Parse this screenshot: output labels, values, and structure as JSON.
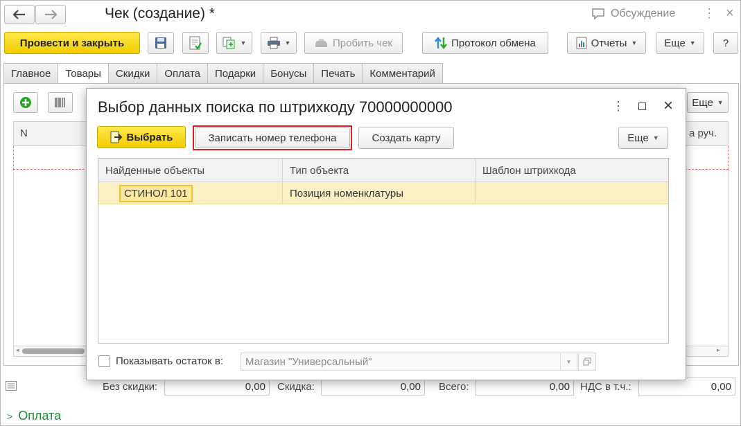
{
  "window": {
    "title": "Чек (создание) *",
    "discussion_label": "Обсуждение"
  },
  "toolbar": {
    "post_close_label": "Провести и закрыть",
    "print_check_label": "Пробить чек",
    "exchange_log_label": "Протокол обмена",
    "reports_label": "Отчеты",
    "more_label": "Еще",
    "help_label": "?"
  },
  "tabs": [
    {
      "label": "Главное"
    },
    {
      "label": "Товары"
    },
    {
      "label": "Скидки"
    },
    {
      "label": "Оплата"
    },
    {
      "label": "Подарки"
    },
    {
      "label": "Бонусы"
    },
    {
      "label": "Печать"
    },
    {
      "label": "Комментарий"
    }
  ],
  "goods": {
    "more_label": "Еще",
    "col_n": "N",
    "col_manual": "а руч."
  },
  "dialog": {
    "title": "Выбор данных поиска по штрихкоду 70000000000",
    "select_label": "Выбрать",
    "record_phone_label": "Записать номер телефона",
    "create_card_label": "Создать карту",
    "more_label": "Еще",
    "columns": [
      "Найденные объекты",
      "Тип объекта",
      "Шаблон штрихкода"
    ],
    "rows": [
      {
        "object": "СТИНОЛ 101",
        "type": "Позиция номенклатуры",
        "template": ""
      }
    ],
    "show_stock_label": "Показывать остаток в:",
    "store_value": "Магазин \"Универсальный\""
  },
  "totals": {
    "without_discount_label": "Без скидки:",
    "without_discount_value": "0,00",
    "discount_label": "Скидка:",
    "discount_value": "0,00",
    "total_label": "Всего:",
    "total_value": "0,00",
    "vat_label": "НДС в т.ч.:",
    "vat_value": "0,00"
  },
  "payment_section": {
    "label": "Оплата"
  },
  "colors": {
    "accent_yellow": "#f5d200",
    "highlight_red": "#e02020",
    "green": "#2aa52a"
  }
}
